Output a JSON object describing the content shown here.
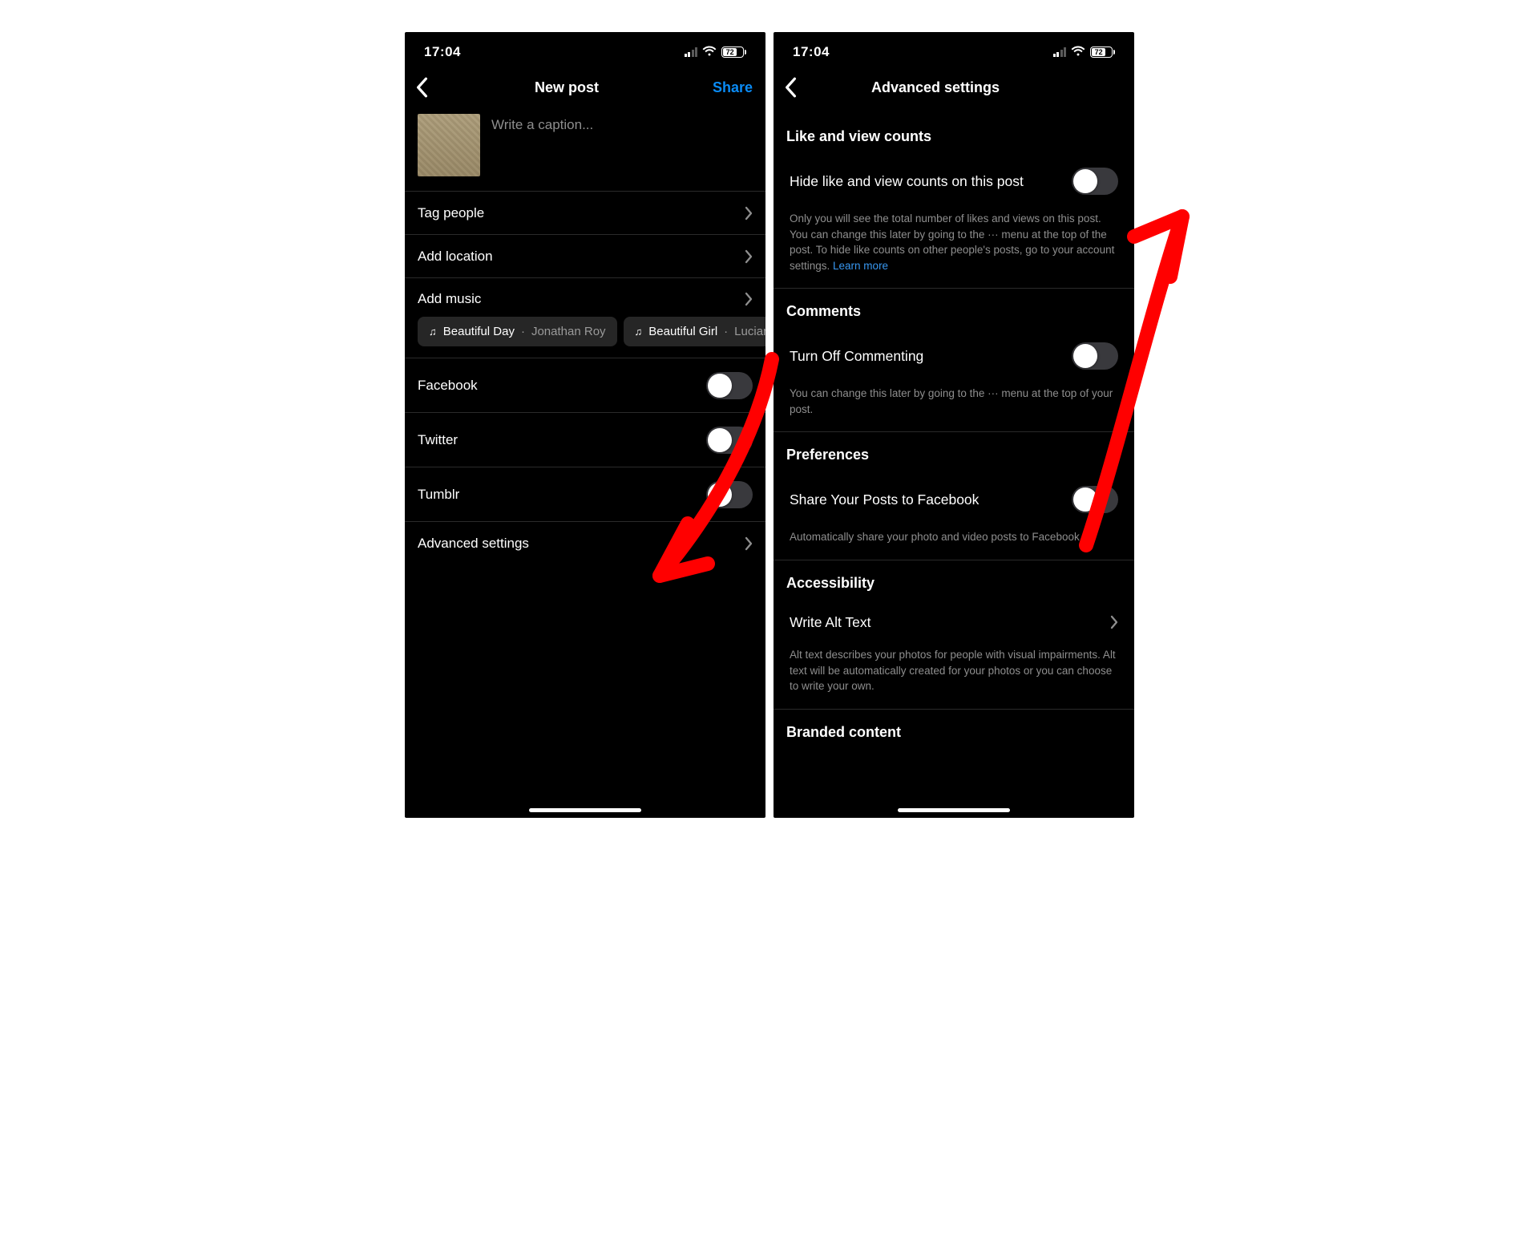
{
  "status": {
    "time": "17:04",
    "battery": "72"
  },
  "left": {
    "title": "New post",
    "share": "Share",
    "caption_placeholder": "Write a caption...",
    "tag_people": "Tag people",
    "add_location": "Add location",
    "add_music": "Add music",
    "music_chips": [
      {
        "title": "Beautiful Day",
        "artist": "Jonathan Roy"
      },
      {
        "title": "Beautiful Girl",
        "artist": "Lucian"
      }
    ],
    "facebook": "Facebook",
    "twitter": "Twitter",
    "tumblr": "Tumblr",
    "advanced": "Advanced settings"
  },
  "right": {
    "title": "Advanced settings",
    "likes_section": "Like and view counts",
    "hide_likes": "Hide like and view counts on this post",
    "hide_likes_desc": "Only you will see the total number of likes and views on this post. You can change this later by going to the ··· menu at the top of the post. To hide like counts on other people's posts, go to your account settings. ",
    "learn_more": "Learn more",
    "comments_section": "Comments",
    "turn_off_commenting": "Turn Off Commenting",
    "comments_desc": "You can change this later by going to the ··· menu at the top of your post.",
    "prefs_section": "Preferences",
    "share_fb": "Share Your Posts to Facebook",
    "share_fb_desc": "Automatically share your photo and video posts to Facebook.",
    "access_section": "Accessibility",
    "alt_text": "Write Alt Text",
    "alt_text_desc": "Alt text describes your photos for people with visual impairments. Alt text will be automatically created for your photos or you can choose to write your own.",
    "branded_section": "Branded content"
  },
  "colors": {
    "accent_link": "#0a8bf5",
    "annotation": "#ff0000"
  }
}
